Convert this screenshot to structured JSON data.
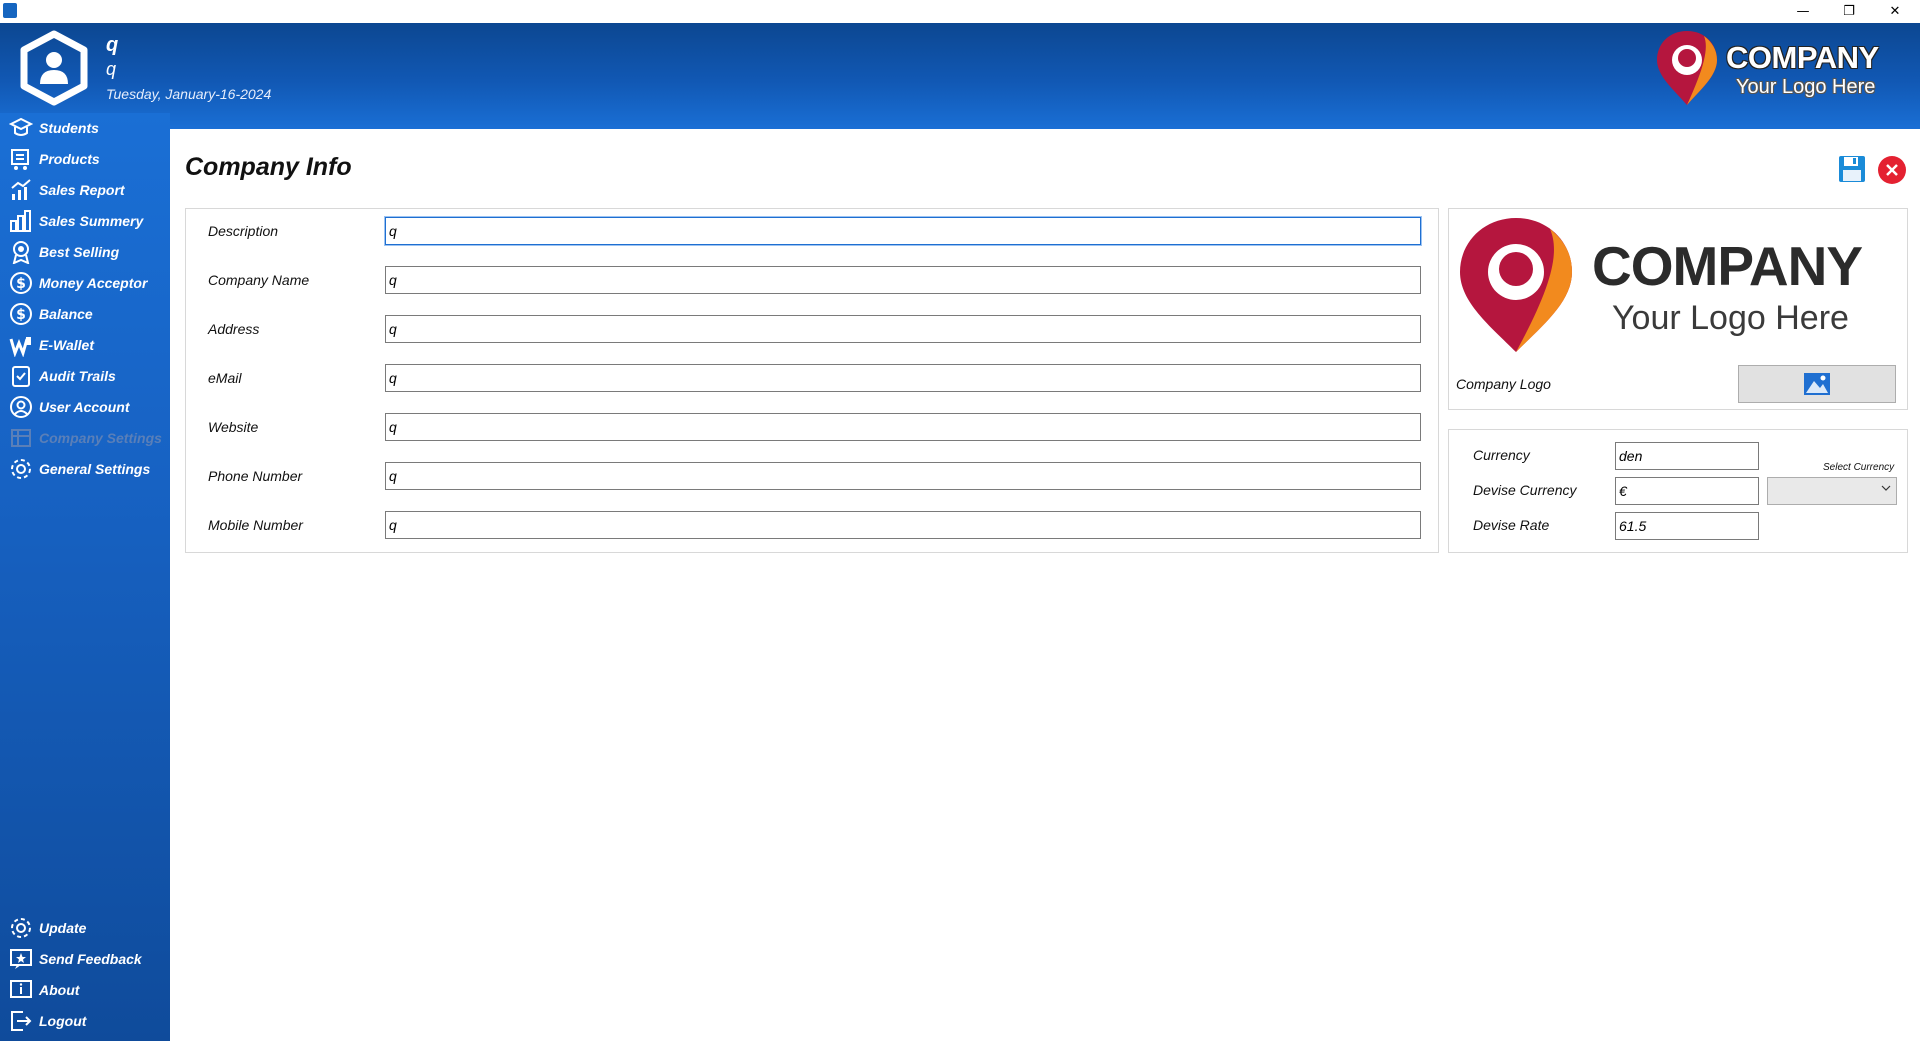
{
  "window": {
    "minimize_glyph": "—",
    "restore_glyph": "❐",
    "close_glyph": "✕"
  },
  "header": {
    "user_name": "q",
    "user_role": "q",
    "date": "Tuesday, January-16-2024",
    "brand_name": "COMPANY",
    "brand_tagline": "Your Logo Here"
  },
  "sidebar": {
    "items": [
      {
        "label": "Students",
        "icon": "students-icon"
      },
      {
        "label": "Products",
        "icon": "products-icon"
      },
      {
        "label": "Sales Report",
        "icon": "sales-report-icon"
      },
      {
        "label": "Sales Summery",
        "icon": "sales-summary-icon"
      },
      {
        "label": "Best Selling",
        "icon": "best-selling-icon"
      },
      {
        "label": "Money Acceptor",
        "icon": "money-acceptor-icon"
      },
      {
        "label": "Balance",
        "icon": "balance-icon"
      },
      {
        "label": "E-Wallet",
        "icon": "e-wallet-icon"
      },
      {
        "label": "Audit Trails",
        "icon": "audit-trails-icon"
      },
      {
        "label": "User Account",
        "icon": "user-account-icon"
      },
      {
        "label": "Company Settings",
        "icon": "company-settings-icon",
        "active": true
      },
      {
        "label": "General Settings",
        "icon": "general-settings-icon"
      }
    ],
    "bottom_items": [
      {
        "label": "Update",
        "icon": "update-icon"
      },
      {
        "label": "Send Feedback",
        "icon": "feedback-icon"
      },
      {
        "label": "About",
        "icon": "about-icon"
      },
      {
        "label": "Logout",
        "icon": "logout-icon"
      }
    ]
  },
  "page": {
    "title": "Company Info"
  },
  "form": {
    "fields": [
      {
        "label": "Description",
        "value": "q"
      },
      {
        "label": "Company Name",
        "value": "q"
      },
      {
        "label": "Address",
        "value": "q"
      },
      {
        "label": "eMail",
        "value": "q"
      },
      {
        "label": "Website",
        "value": "q"
      },
      {
        "label": "Phone Number",
        "value": "q"
      },
      {
        "label": "Mobile Number",
        "value": "q"
      }
    ]
  },
  "logo_panel": {
    "logo_name": "COMPANY",
    "logo_tagline": "Your Logo Here",
    "label": "Company Logo"
  },
  "currency_panel": {
    "currency_label": "Currency",
    "currency_value": "den",
    "devise_currency_label": "Devise Currency",
    "devise_currency_value": "€",
    "devise_rate_label": "Devise Rate",
    "devise_rate_value": "61.5",
    "select_currency_label": "Select Currency",
    "select_currency_value": ""
  },
  "colors": {
    "header_top": "#0c4791",
    "sidebar": "#1762c3",
    "close_red": "#e42131",
    "save_blue": "#1a8bd8",
    "logo_red": "#b5163e",
    "logo_orange": "#f28a1e"
  }
}
